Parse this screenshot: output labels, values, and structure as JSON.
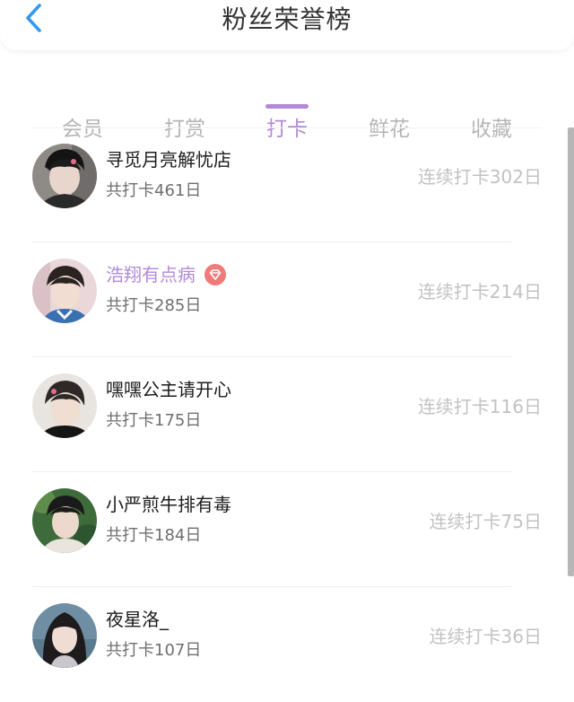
{
  "header": {
    "title": "粉丝荣誉榜",
    "back_icon": "chevron-left-icon",
    "accent": "#3399ee"
  },
  "tabs": [
    {
      "label": "会员",
      "active": false
    },
    {
      "label": "打赏",
      "active": false
    },
    {
      "label": "打卡",
      "active": true
    },
    {
      "label": "鲜花",
      "active": false
    },
    {
      "label": "收藏",
      "active": false
    }
  ],
  "colors": {
    "active_tab": "#b38ad8",
    "inactive_tab": "#b5b5b5",
    "vip_badge": "#f07a7a"
  },
  "fans": [
    {
      "name": "寻觅月亮解忧店",
      "total": "共打卡461日",
      "streak": "连续打卡302日",
      "vip": false
    },
    {
      "name": "浩翔有点病",
      "total": "共打卡285日",
      "streak": "连续打卡214日",
      "vip": true
    },
    {
      "name": "嘿嘿公主请开心",
      "total": "共打卡175日",
      "streak": "连续打卡116日",
      "vip": false
    },
    {
      "name": "小严煎牛排有毒",
      "total": "共打卡184日",
      "streak": "连续打卡75日",
      "vip": false
    },
    {
      "name": "夜星洛_",
      "total": "共打卡107日",
      "streak": "连续打卡36日",
      "vip": false
    }
  ]
}
